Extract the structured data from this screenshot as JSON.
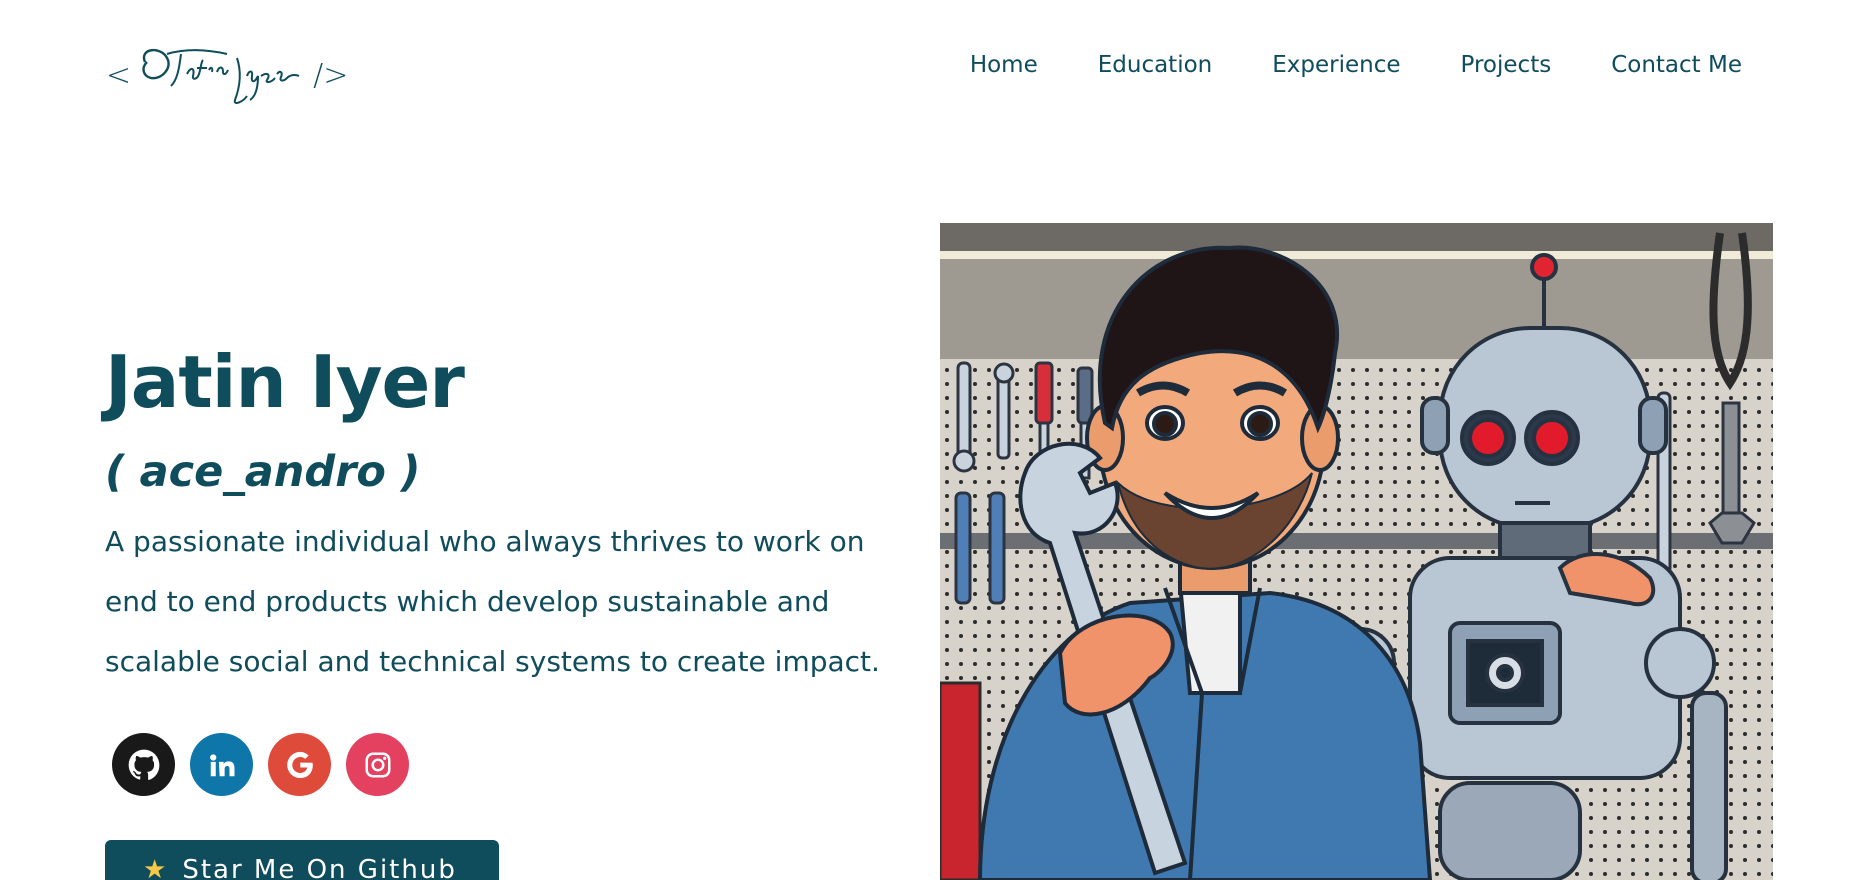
{
  "header": {
    "logo_open": "<",
    "logo_signature": "Jatin Iyer",
    "logo_close": "/>",
    "nav": [
      "Home",
      "Education",
      "Experience",
      "Projects",
      "Contact Me"
    ]
  },
  "hero": {
    "name": "Jatin Iyer",
    "handle": "( ace_andro )",
    "description_lines": [
      "A passionate individual who always thrives to work on",
      "end to end products which develop sustainable and",
      "scalable social and technical systems to create impact."
    ],
    "socials": [
      {
        "name": "github",
        "icon": "github-icon",
        "color": "#191919"
      },
      {
        "name": "linkedin",
        "icon": "linkedin-icon",
        "color": "#0e76a8"
      },
      {
        "name": "google",
        "icon": "google-icon",
        "color": "#df4b3b"
      },
      {
        "name": "instagram",
        "icon": "instagram-icon",
        "color": "#e4405f"
      }
    ],
    "star_button": {
      "icon": "star-icon",
      "label": "Star Me On Github"
    }
  },
  "colors": {
    "primary": "#0f4c5c",
    "background": "#ffffff"
  }
}
